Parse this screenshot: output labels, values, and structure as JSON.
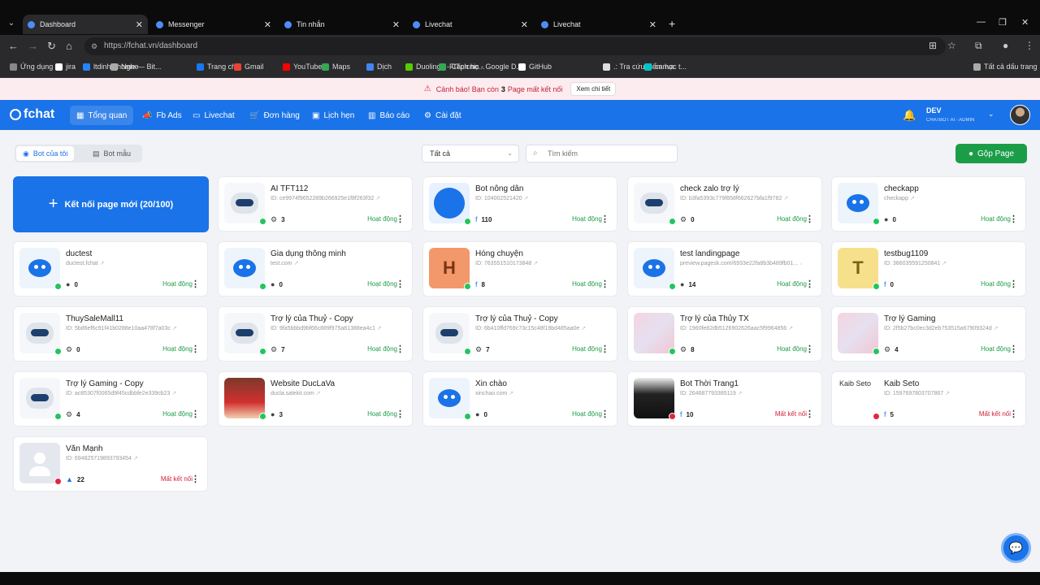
{
  "browser": {
    "tabs": [
      {
        "title": "Dashboard",
        "color": "#4d8df6"
      },
      {
        "title": "Messenger",
        "color": "#4d8df6"
      },
      {
        "title": "Tin nhắn",
        "color": "#4d8df6"
      },
      {
        "title": "Livechat",
        "color": "#4d8df6"
      },
      {
        "title": "Livechat",
        "color": "#4d8df6"
      }
    ],
    "url": "https://fchat.vn/dashboard",
    "bookmarks": [
      {
        "label": "Ứng dụng",
        "color": "#888"
      },
      {
        "label": "jira",
        "color": "#fff"
      },
      {
        "label": "ltdinh / home — Bit...",
        "color": "#2684ff"
      },
      {
        "label": "Nghe",
        "color": "#aaa"
      },
      {
        "label": "Trang chủ",
        "color": "#1877f2"
      },
      {
        "label": "Gmail",
        "color": "#ea4335"
      },
      {
        "label": "YouTube",
        "color": "#ff0000"
      },
      {
        "label": "Maps",
        "color": "#34a853"
      },
      {
        "label": "Dịch",
        "color": "#4285f4"
      },
      {
        "label": "Duolingo - Cách họ...",
        "color": "#58cc02"
      },
      {
        "label": "FITpicnic - Google D...",
        "color": "#34a853"
      },
      {
        "label": "GitHub",
        "color": "#fff"
      },
      {
        "label": ".: Tra cứu điểm học t...",
        "color": "#ddd"
      },
      {
        "label": "canva",
        "color": "#00c4cc"
      },
      {
        "label": "Tất cả dấu trang",
        "color": "#aaa"
      }
    ]
  },
  "warning": {
    "prefix": "Cảnh báo! Bạn còn",
    "count": "3",
    "suffix": "Page mất kết nối",
    "button": "Xem chi tiết"
  },
  "nav": {
    "logo": "fchat",
    "items": [
      "Tổng quan",
      "Fb Ads",
      "Livechat",
      "Đơn hàng",
      "Lịch hẹn",
      "Báo cáo",
      "Cài đặt"
    ],
    "user_name": "DEV",
    "user_role": "CHATBOT AI - ADMIN"
  },
  "toolbar": {
    "tab_mine": "Bot của tôi",
    "tab_template": "Bot mẫu",
    "filter": "Tất cả",
    "search_placeholder": "Tìm kiếm",
    "merge": "Gộp Page"
  },
  "connect_label": "Kết nối page mới (20/100)",
  "status_active": "Hoạt động",
  "status_lost": "Mất kết nối",
  "bots": [
    {
      "name": "AI TFT112",
      "sub": "ID: ce9974f9652289b266925e1f8f263f32",
      "count": "3",
      "src": "ai",
      "avatar": "robot",
      "status": "active"
    },
    {
      "name": "Bot nông dân",
      "sub": "ID: 104002521420",
      "count": "110",
      "src": "fb",
      "avatar": "bluebot",
      "status": "active"
    },
    {
      "name": "check zalo trợ lý",
      "sub": "ID: b3fa5393c779f858f662627bfa1f9782",
      "count": "0",
      "src": "ai",
      "avatar": "robot",
      "status": "active"
    },
    {
      "name": "checkapp",
      "sub": "checkapp",
      "count": "0",
      "src": "web",
      "avatar": "bot",
      "status": "active"
    },
    {
      "name": "ductest",
      "sub": "ductest.fchat",
      "count": "0",
      "src": "web",
      "avatar": "bot",
      "status": "active"
    },
    {
      "name": "Gia dụng thông minh",
      "sub": "test.com",
      "count": "0",
      "src": "web",
      "avatar": "bot",
      "status": "active"
    },
    {
      "name": "Hóng chuyện",
      "sub": "ID: 763551510173848",
      "count": "8",
      "src": "fb",
      "avatar": "letterH",
      "status": "active"
    },
    {
      "name": "test landingpage",
      "sub": "preview.pagesk.com/6933e22fa8b3b489fb01...",
      "count": "14",
      "src": "web",
      "avatar": "bot",
      "status": "active"
    },
    {
      "name": "testbug1109",
      "sub": "ID: 386035591250841",
      "count": "0",
      "src": "fb",
      "avatar": "letterT",
      "status": "active"
    },
    {
      "name": "ThuySaleMall11",
      "sub": "ID: 5bd6ef6c91f41b0288e10aa478f7a03c",
      "count": "0",
      "src": "ai",
      "avatar": "robot",
      "status": "active"
    },
    {
      "name": "Trợ lý của Thuỷ - Copy",
      "sub": "ID: 9fa5bbbd9bf66c889f975a81388ea4c1",
      "count": "7",
      "src": "ai",
      "avatar": "robot",
      "status": "active"
    },
    {
      "name": "Trợ lý của Thuỷ - Copy",
      "sub": "ID: 6b410ffd769c73c15c48f19bd485aa0e",
      "count": "7",
      "src": "ai",
      "avatar": "robot",
      "status": "active"
    },
    {
      "name": "Trợ lý của Thủy TX",
      "sub": "ID: 1960fe82db5126902626aac5f9964856",
      "count": "8",
      "src": "ai",
      "avatar": "anime",
      "status": "active"
    },
    {
      "name": "Trợ lý Gaming",
      "sub": "ID: 2f5b27bc0ec3d2eb753515a67909324d",
      "count": "4",
      "src": "ai",
      "avatar": "anime",
      "status": "active"
    },
    {
      "name": "Trợ lý Gaming - Copy",
      "sub": "ID: ac85307f0065d9f45cdbbfe2e339cb23",
      "count": "4",
      "src": "ai",
      "avatar": "robot",
      "status": "active"
    },
    {
      "name": "Website DucLaVa",
      "sub": "ducla.salekit.com",
      "count": "3",
      "src": "web",
      "avatar": "photo1",
      "status": "active"
    },
    {
      "name": "Xin chào",
      "sub": "xinchao.com",
      "count": "0",
      "src": "web",
      "avatar": "bot",
      "status": "active"
    },
    {
      "name": "Bot Thời Trang1",
      "sub": "ID: 264687793385119",
      "count": "10",
      "src": "fb",
      "avatar": "photo2",
      "status": "lost"
    },
    {
      "name": "Kaib Seto",
      "sub": "ID: 1597697803707867",
      "count": "5",
      "src": "fb",
      "avatar": "broken",
      "avatar_text": "Kaib Seto",
      "status": "lost"
    },
    {
      "name": "Văn Mạnh",
      "sub": "ID: 694825719893793454",
      "count": "22",
      "src": "zalo",
      "avatar": "person",
      "status": "lost"
    }
  ]
}
